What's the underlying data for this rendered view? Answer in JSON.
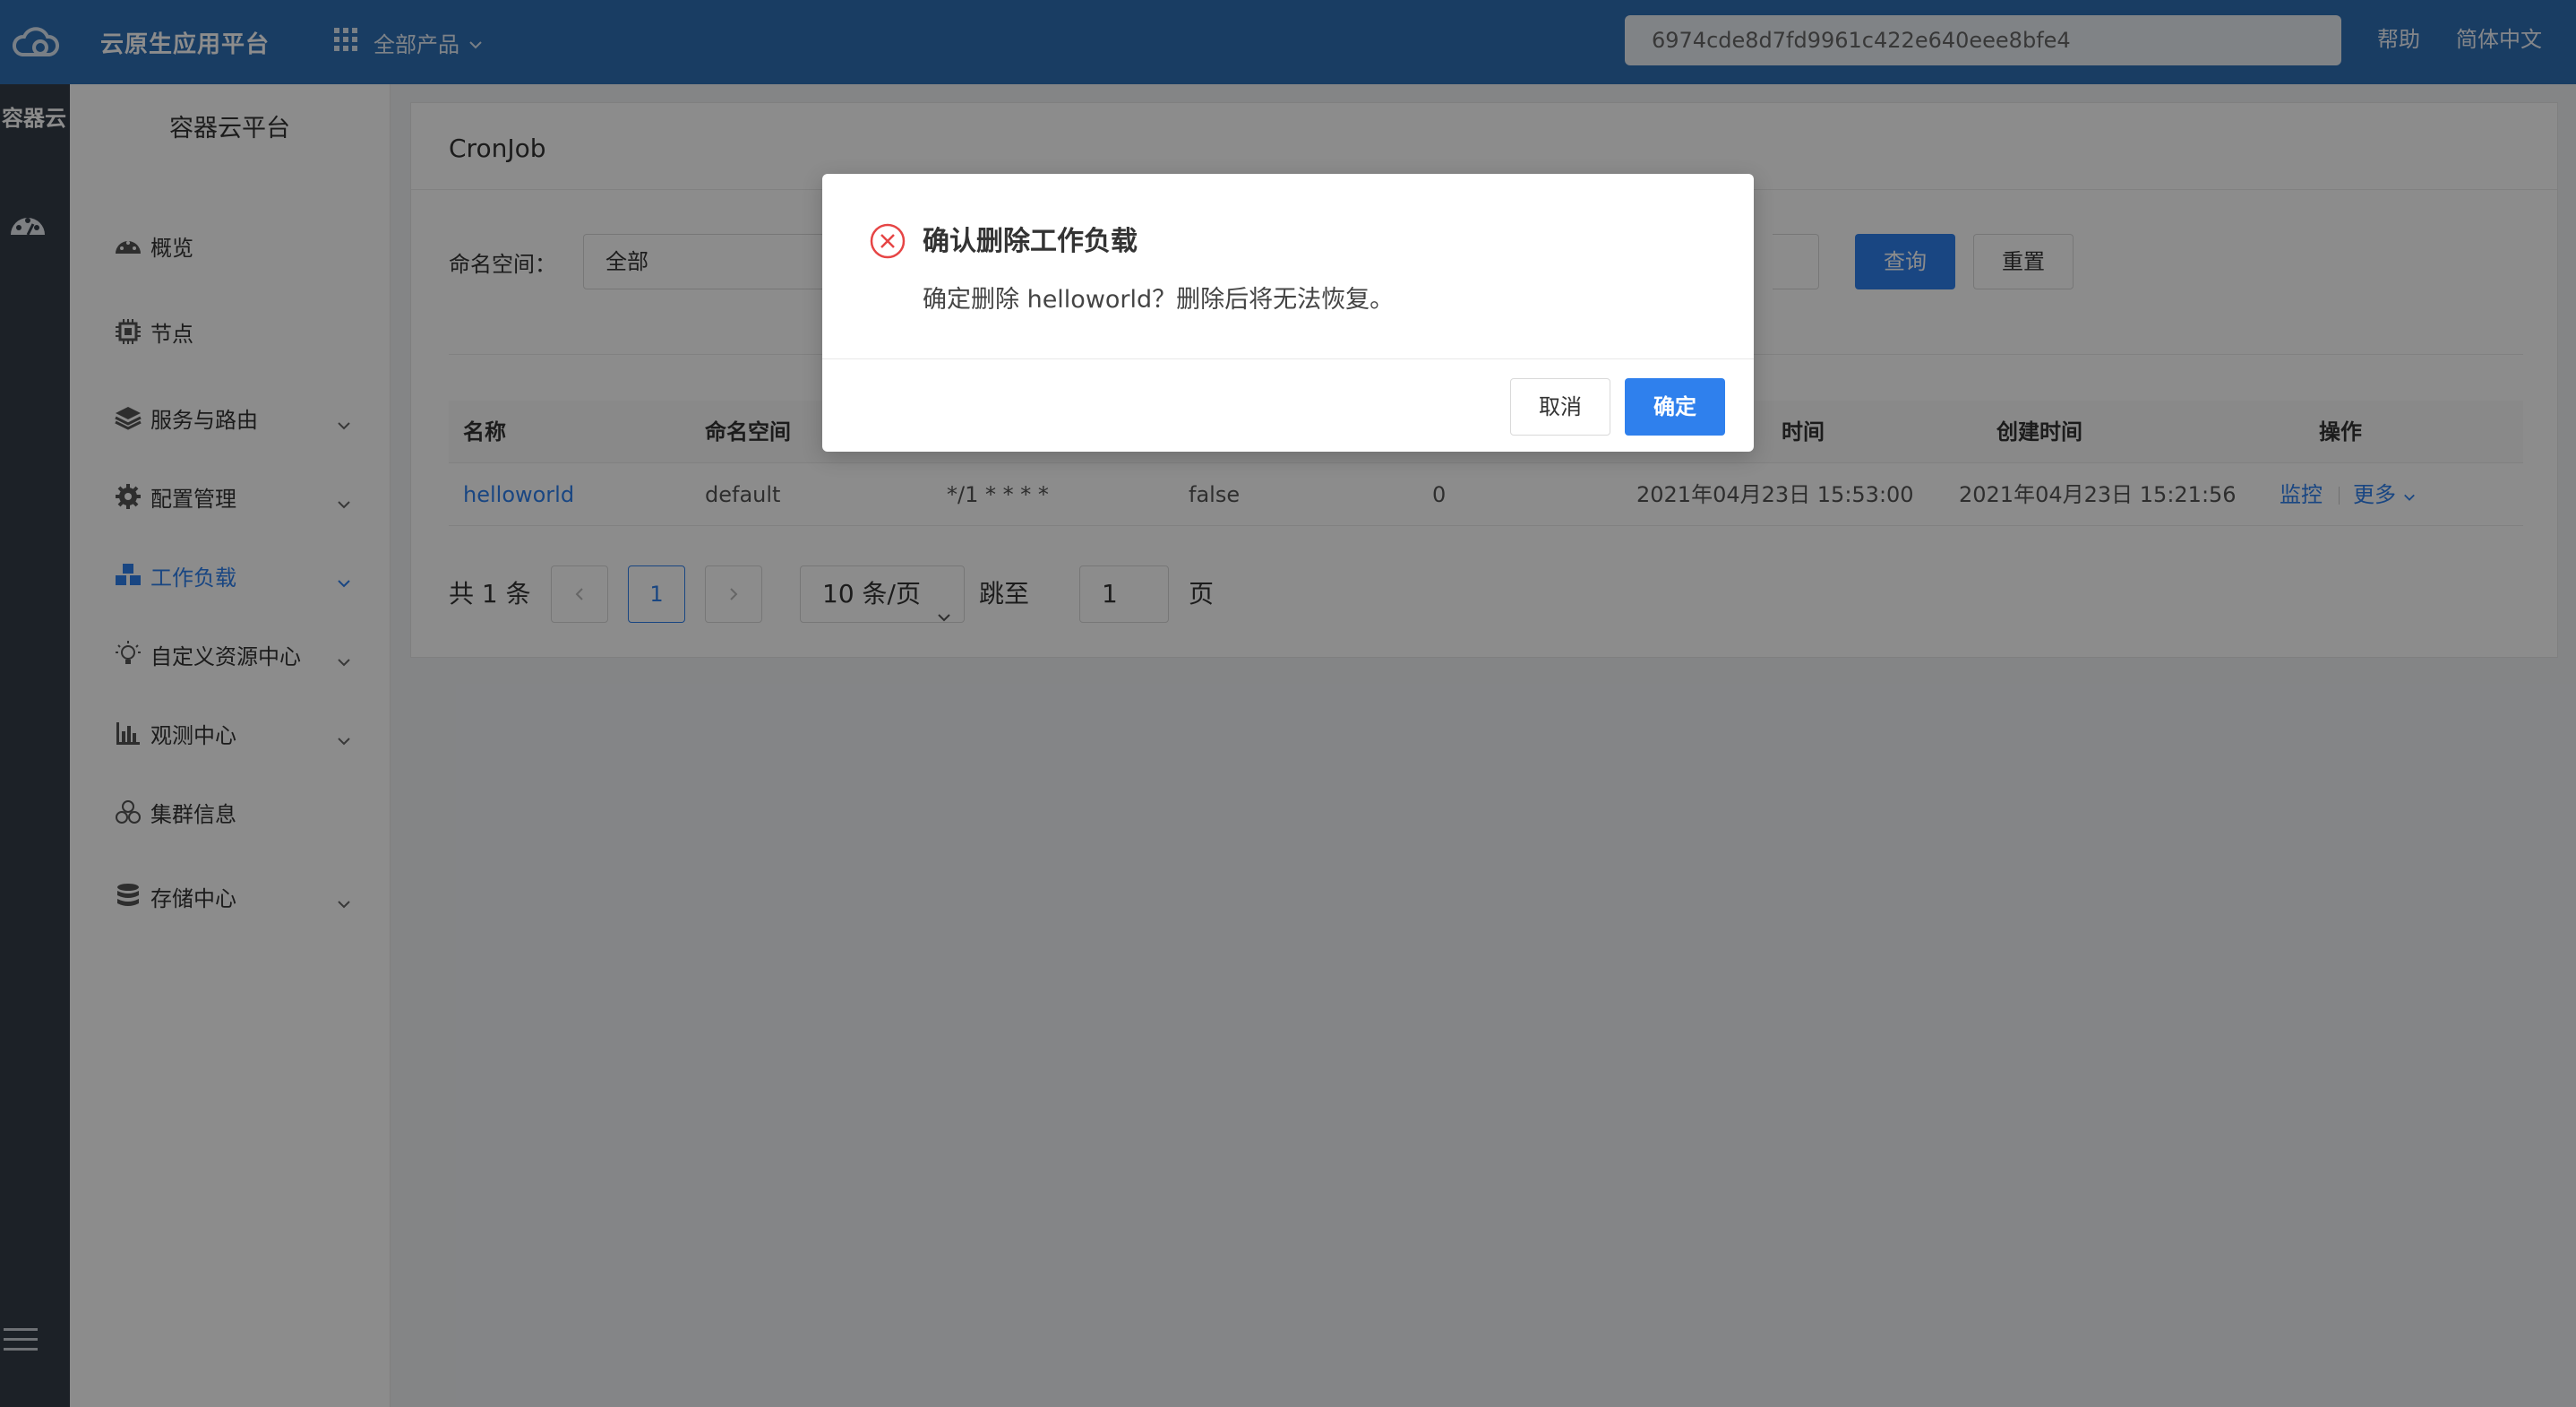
{
  "header": {
    "brand": "云原生应用平台",
    "products": "全部产品",
    "search_value": "6974cde8d7fd9961c422e640eee8bfe4",
    "help": "帮助",
    "language": "简体中文"
  },
  "rail": {
    "title": "容器云"
  },
  "sidebar": {
    "title": "容器云平台",
    "items": [
      {
        "label": "概览",
        "icon": "dashboard-icon"
      },
      {
        "label": "节点",
        "icon": "chip-icon"
      },
      {
        "label": "服务与路由",
        "icon": "layers-icon"
      },
      {
        "label": "配置管理",
        "icon": "gear-icon"
      },
      {
        "label": "工作负载",
        "icon": "cubes-icon",
        "active": true
      },
      {
        "label": "自定义资源中心",
        "icon": "bulb-icon"
      },
      {
        "label": "观测中心",
        "icon": "bar-chart-icon"
      },
      {
        "label": "集群信息",
        "icon": "cluster-icon"
      },
      {
        "label": "存储中心",
        "icon": "database-icon"
      }
    ]
  },
  "page": {
    "title": "CronJob",
    "namespace_label": "命名空间：",
    "namespace_value": "全部",
    "query": "查询",
    "reset": "重置"
  },
  "table": {
    "headers": [
      "名称",
      "命名空间",
      "",
      "",
      "",
      "时间",
      "创建时间",
      "操作"
    ],
    "rows": [
      {
        "name": "helloworld",
        "namespace": "default",
        "schedule": "*/1 * * * *",
        "suspend": "false",
        "active": "0",
        "last_time": "2021年04月23日 15:53:00",
        "created": "2021年04月23日 15:21:56",
        "action_monitor": "监控",
        "action_more": "更多"
      }
    ]
  },
  "pagination": {
    "total": "共 1 条",
    "current": "1",
    "page_size": "10 条/页",
    "jump_label": "跳至",
    "jump_value": "1",
    "page_unit": "页"
  },
  "modal": {
    "title": "确认删除工作负载",
    "message": "确定删除 helloworld？删除后将无法恢复。",
    "cancel": "取消",
    "confirm": "确定"
  },
  "colors": {
    "header_bg": "#2f6fb5",
    "rail_bg": "#333c48",
    "primary": "#2f80ed",
    "danger": "#e64545"
  }
}
